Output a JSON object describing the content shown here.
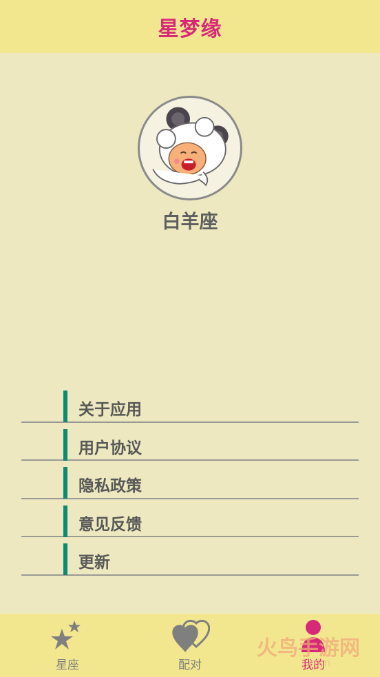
{
  "header": {
    "title": "星梦缘"
  },
  "profile": {
    "name": "白羊座",
    "avatar_icon": "aries-ram-mascot-icon"
  },
  "menu": {
    "items": [
      {
        "label": "关于应用"
      },
      {
        "label": "用户协议"
      },
      {
        "label": "隐私政策"
      },
      {
        "label": "意见反馈"
      },
      {
        "label": "更新"
      }
    ]
  },
  "bottom_nav": {
    "tabs": [
      {
        "label": "星座",
        "icon": "stars-icon",
        "active": false
      },
      {
        "label": "配对",
        "icon": "hearts-icon",
        "active": false
      },
      {
        "label": "我的",
        "icon": "person-icon",
        "active": true
      }
    ]
  },
  "watermark": {
    "text": "火鸟手游网",
    "url": "j.com"
  },
  "colors": {
    "header_bg": "#F2E78F",
    "title": "#D62A78",
    "page_bg": "#EDE8C0",
    "accent_bar": "#0E8A73",
    "active_tab": "#D62A78",
    "inactive_tab": "#7F7F7F"
  }
}
